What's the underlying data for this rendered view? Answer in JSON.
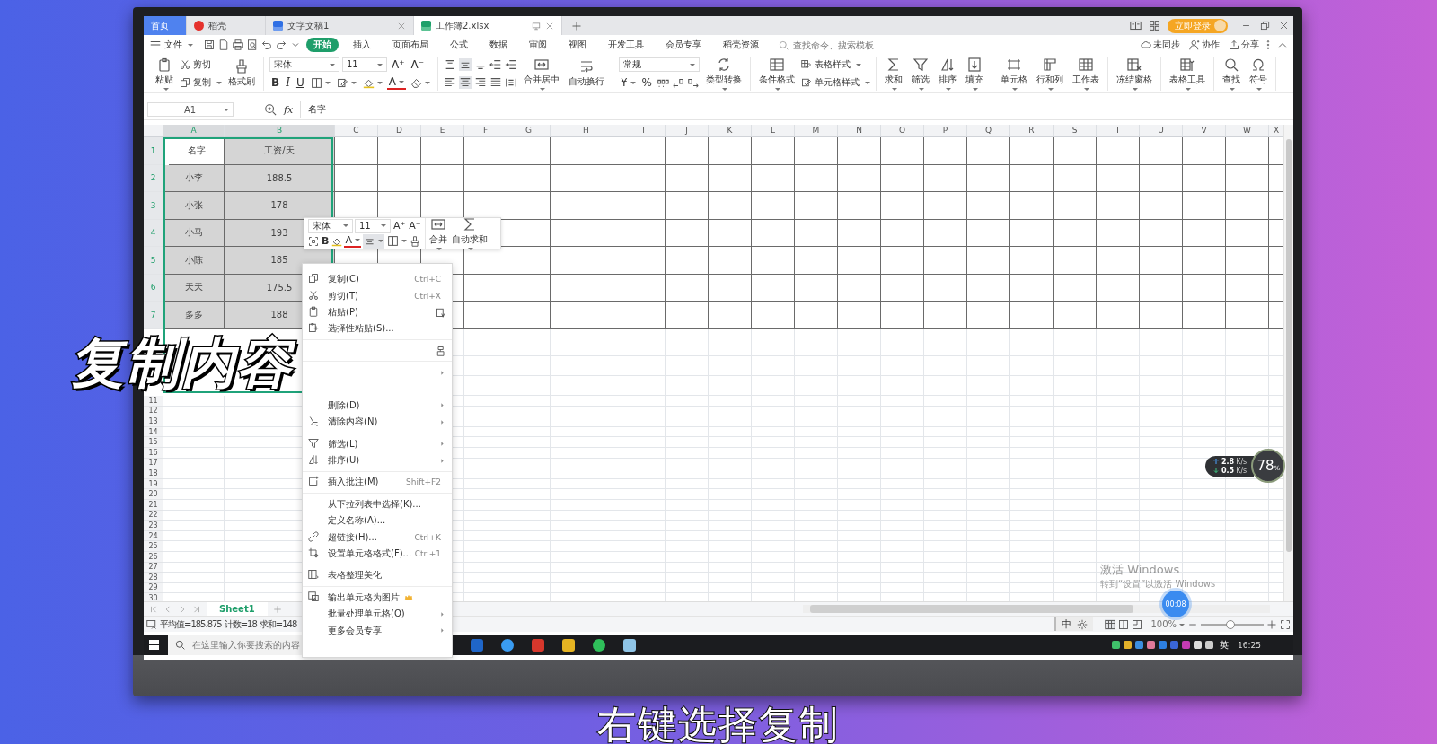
{
  "title_bar": {
    "tabs": [
      {
        "label": "首页",
        "kind": "home",
        "selected": false,
        "closable": false
      },
      {
        "label": "稻壳",
        "kind": "docer",
        "selected": false,
        "closable": false
      },
      {
        "label": "文字文稿1",
        "kind": "writer",
        "selected": false,
        "closable": true
      },
      {
        "label": "工作簿2.xlsx",
        "kind": "sheet",
        "selected": true,
        "closable": true
      }
    ],
    "login": "立即登录"
  },
  "menu_bar": {
    "file": "文件",
    "tabs": [
      {
        "label": "开始",
        "selected": true
      },
      {
        "label": "插入",
        "selected": false
      },
      {
        "label": "页面布局",
        "selected": false
      },
      {
        "label": "公式",
        "selected": false
      },
      {
        "label": "数据",
        "selected": false
      },
      {
        "label": "审阅",
        "selected": false
      },
      {
        "label": "视图",
        "selected": false
      },
      {
        "label": "开发工具",
        "selected": false
      },
      {
        "label": "会员专享",
        "selected": false
      },
      {
        "label": "稻壳资源",
        "selected": false
      }
    ],
    "search": {
      "placeholder": "查找命令、搜索模板"
    },
    "actions": [
      "未同步",
      "协作",
      "分享"
    ]
  },
  "ribbon": {
    "paste": "粘贴",
    "cut": "剪切",
    "copy": "复制",
    "format_painter": "格式刷",
    "font": "宋体",
    "font_size": "11",
    "grow_font": "A⁺",
    "shrink_font": "A⁻",
    "bold": "B",
    "italic": "I",
    "underline": "U",
    "font_color": "A",
    "merge": "合并居中",
    "wrap": "自动换行",
    "number_format": "常规",
    "currency": "¥",
    "percent": "%",
    "convert": "类型转换",
    "conditional_format": "条件格式",
    "table_style": "表格样式",
    "cell_style": "单元格样式",
    "large_buttons": [
      "求和",
      "筛选",
      "排序",
      "填充",
      "单元格",
      "行和列",
      "工作表",
      "冻结窗格",
      "表格工具",
      "查找",
      "符号"
    ]
  },
  "formula_bar": {
    "name_box": "A1",
    "function_label": "fx",
    "value": "名字"
  },
  "sheet": {
    "columns": [
      {
        "label": "A",
        "selected": true
      },
      {
        "label": "B",
        "selected": true
      },
      {
        "label": "C",
        "selected": false
      },
      {
        "label": "D",
        "selected": false
      },
      {
        "label": "E",
        "selected": false
      },
      {
        "label": "F",
        "selected": false
      },
      {
        "label": "G",
        "selected": false
      },
      {
        "label": "H",
        "selected": false
      },
      {
        "label": "I",
        "selected": false
      },
      {
        "label": "J",
        "selected": false
      },
      {
        "label": "K",
        "selected": false
      },
      {
        "label": "L",
        "selected": false
      },
      {
        "label": "M",
        "selected": false
      },
      {
        "label": "N",
        "selected": false
      },
      {
        "label": "O",
        "selected": false
      },
      {
        "label": "P",
        "selected": false
      },
      {
        "label": "Q",
        "selected": false
      },
      {
        "label": "R",
        "selected": false
      },
      {
        "label": "S",
        "selected": false
      },
      {
        "label": "T",
        "selected": false
      },
      {
        "label": "U",
        "selected": false
      },
      {
        "label": "V",
        "selected": false
      },
      {
        "label": "W",
        "selected": false
      },
      {
        "label": "X",
        "selected": false
      }
    ],
    "rows": [
      {
        "number": "1",
        "selected": true,
        "cells": [
          {
            "text": "名字",
            "selected": false
          },
          {
            "text": "工资/天",
            "selected": true
          }
        ]
      },
      {
        "number": "2",
        "selected": true,
        "cells": [
          {
            "text": "小李",
            "selected": true
          },
          {
            "text": "188.5",
            "selected": true
          }
        ]
      },
      {
        "number": "3",
        "selected": true,
        "cells": [
          {
            "text": "小张",
            "selected": true
          },
          {
            "text": "178",
            "selected": true
          }
        ]
      },
      {
        "number": "4",
        "selected": true,
        "cells": [
          {
            "text": "小马",
            "selected": true
          },
          {
            "text": "193",
            "selected": true
          }
        ]
      },
      {
        "number": "5",
        "selected": true,
        "cells": [
          {
            "text": "小陈",
            "selected": true
          },
          {
            "text": "185",
            "selected": true
          }
        ]
      },
      {
        "number": "6",
        "selected": true,
        "cells": [
          {
            "text": "天天",
            "selected": true
          },
          {
            "text": "175.5",
            "selected": true
          }
        ]
      },
      {
        "number": "7",
        "selected": true,
        "cells": [
          {
            "text": "多多",
            "selected": true
          },
          {
            "text": "188",
            "selected": true
          }
        ]
      },
      {
        "number": "11",
        "selected": false
      },
      {
        "number": "12",
        "selected": false
      },
      {
        "number": "13",
        "selected": false
      },
      {
        "number": "14",
        "selected": false
      },
      {
        "number": "15",
        "selected": false
      },
      {
        "number": "16",
        "selected": false
      },
      {
        "number": "17",
        "selected": false
      },
      {
        "number": "18",
        "selected": false
      },
      {
        "number": "19",
        "selected": false
      },
      {
        "number": "20",
        "selected": false
      },
      {
        "number": "21",
        "selected": false
      },
      {
        "number": "22",
        "selected": false
      },
      {
        "number": "23",
        "selected": false
      },
      {
        "number": "24",
        "selected": false
      },
      {
        "number": "25",
        "selected": false
      },
      {
        "number": "26",
        "selected": false
      },
      {
        "number": "27",
        "selected": false
      },
      {
        "number": "28",
        "selected": false
      },
      {
        "number": "29",
        "selected": false
      },
      {
        "number": "30",
        "selected": false
      }
    ]
  },
  "sheet_tabs": [
    {
      "label": "Sheet1",
      "selected": true
    }
  ],
  "status_bar": {
    "stats": [
      "平均值=185.875",
      "计数=18",
      "求和=148"
    ],
    "ime": "中",
    "zoom": "100%",
    "zoom_slider": {
      "level": 0.45
    }
  },
  "taskbar": {
    "search": {
      "placeholder": "在这里输入你要搜索的内容"
    },
    "language": "英",
    "time": "16:25"
  },
  "mini_toolbar": {
    "font": "宋体",
    "font_size": "11",
    "grow_font": "A⁺",
    "shrink_font": "A⁻",
    "bold": "B",
    "font_color": "A",
    "merge": "合并",
    "autosum": "自动求和"
  },
  "context_menu": {
    "groups": [
      [
        {
          "kind": "entry",
          "label": "复制(C)",
          "shortcut": "Ctrl+C",
          "submenu": false
        },
        {
          "kind": "entry",
          "label": "剪切(T)",
          "shortcut": "Ctrl+X",
          "submenu": false
        },
        {
          "kind": "entry",
          "label": "粘贴(P)",
          "submenu": false
        },
        {
          "kind": "entry",
          "label": "选择性粘贴(S)...",
          "submenu": false
        }
      ],
      [
        {
          "kind": "covered",
          "submenu": false
        }
      ],
      [
        {
          "kind": "covered",
          "submenu": true
        },
        {
          "kind": "covered",
          "submenu": false
        },
        {
          "kind": "entry",
          "label": "删除(D)",
          "submenu": true
        },
        {
          "kind": "entry",
          "label": "清除内容(N)",
          "submenu": true
        }
      ],
      [
        {
          "kind": "entry",
          "label": "筛选(L)",
          "submenu": true
        },
        {
          "kind": "entry",
          "label": "排序(U)",
          "submenu": true
        }
      ],
      [
        {
          "kind": "entry",
          "label": "插入批注(M)",
          "shortcut": "Shift+F2",
          "submenu": false
        }
      ],
      [
        {
          "kind": "entry",
          "label": "从下拉列表中选择(K)...",
          "submenu": false
        },
        {
          "kind": "entry",
          "label": "定义名称(A)...",
          "submenu": false
        },
        {
          "kind": "entry",
          "label": "超链接(H)...",
          "shortcut": "Ctrl+K",
          "submenu": false
        },
        {
          "kind": "entry",
          "label": "设置单元格格式(F)...",
          "shortcut": "Ctrl+1",
          "submenu": false
        }
      ],
      [
        {
          "kind": "entry",
          "label": "表格整理美化",
          "submenu": false
        }
      ],
      [
        {
          "kind": "entry",
          "label": "输出单元格为图片",
          "submenu": false
        },
        {
          "kind": "entry",
          "label": "批量处理单元格(Q)",
          "submenu": true
        },
        {
          "kind": "entry",
          "label": "更多会员专享",
          "submenu": true
        }
      ]
    ]
  },
  "network_monitor": {
    "upload": "2.8",
    "upload_unit": "K/s",
    "download": "0.5",
    "download_unit": "K/s",
    "load": "78",
    "load_unit": "%"
  },
  "activation_notice": {
    "title": "激活 Windows",
    "text": "转到“设置”以激活 Windows"
  },
  "recording_timer": "00:08",
  "captions": {
    "overlay": "复制内容",
    "subtitle": "右键选择复制"
  }
}
